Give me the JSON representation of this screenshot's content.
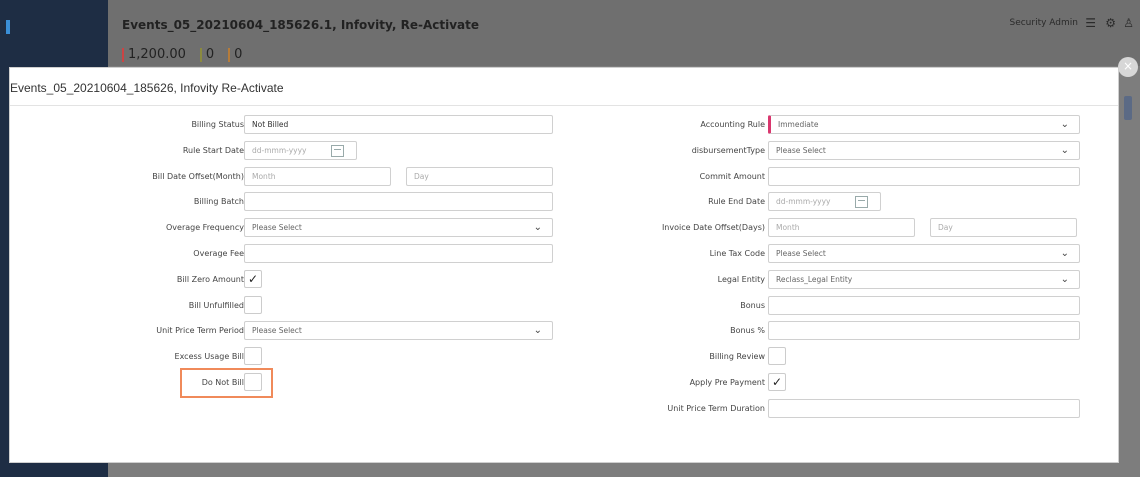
{
  "app": {
    "title": "Events_05_20210604_185626.1, Infovity, Re-Activate",
    "user": "Security Admin",
    "stats": [
      "1,200.00",
      "0",
      "0"
    ]
  },
  "modal": {
    "title": "Events_05_20210604_185626, Infovity  Re-Activate",
    "close": "×"
  },
  "left_fields": [
    {
      "label": "Billing Status",
      "value": "Not Billed"
    },
    {
      "label": "Rule Start Date",
      "placeholder": "dd-mmm-yyyy"
    },
    {
      "label": "Bill Date Offset(Month)",
      "placeholder1": "Month",
      "placeholder2": "Day"
    },
    {
      "label": "Billing Batch",
      "value": ""
    },
    {
      "label": "Overage Frequency",
      "value": "Please Select"
    },
    {
      "label": "Overage Fee",
      "value": ""
    },
    {
      "label": "Bill Zero Amount",
      "checked": "✓"
    },
    {
      "label": "Bill Unfulfilled",
      "checked": ""
    },
    {
      "label": "Unit Price Term Period",
      "value": "Please Select"
    },
    {
      "label": "Excess Usage Bill",
      "checked": ""
    },
    {
      "label": "Do Not Bill",
      "checked": ""
    }
  ],
  "right_fields": [
    {
      "label": "Accounting Rule",
      "value": "Immediate"
    },
    {
      "label": "disbursementType",
      "value": "Please Select"
    },
    {
      "label": "Commit Amount",
      "value": ""
    },
    {
      "label": "Rule End Date",
      "placeholder": "dd-mmm-yyyy"
    },
    {
      "label": "Invoice Date Offset(Days)",
      "placeholder1": "Month",
      "placeholder2": "Day"
    },
    {
      "label": "Line Tax Code",
      "value": "Please Select"
    },
    {
      "label": "Legal Entity",
      "value": "Reclass_Legal Entity"
    },
    {
      "label": "Bonus",
      "value": ""
    },
    {
      "label": "Bonus %",
      "value": ""
    },
    {
      "label": "Billing Review",
      "checked": ""
    },
    {
      "label": "Apply Pre Payment",
      "checked": "✓"
    },
    {
      "label": "Unit Price Term Duration",
      "value": ""
    }
  ],
  "colors": {
    "highlight": "#f08a5a",
    "required_marker": "#d9376e"
  },
  "icons": [
    "list-icon",
    "gear-icon",
    "user-icon",
    "calendar-icon",
    "chevron-down-icon",
    "close-icon",
    "checkmark-icon"
  ]
}
